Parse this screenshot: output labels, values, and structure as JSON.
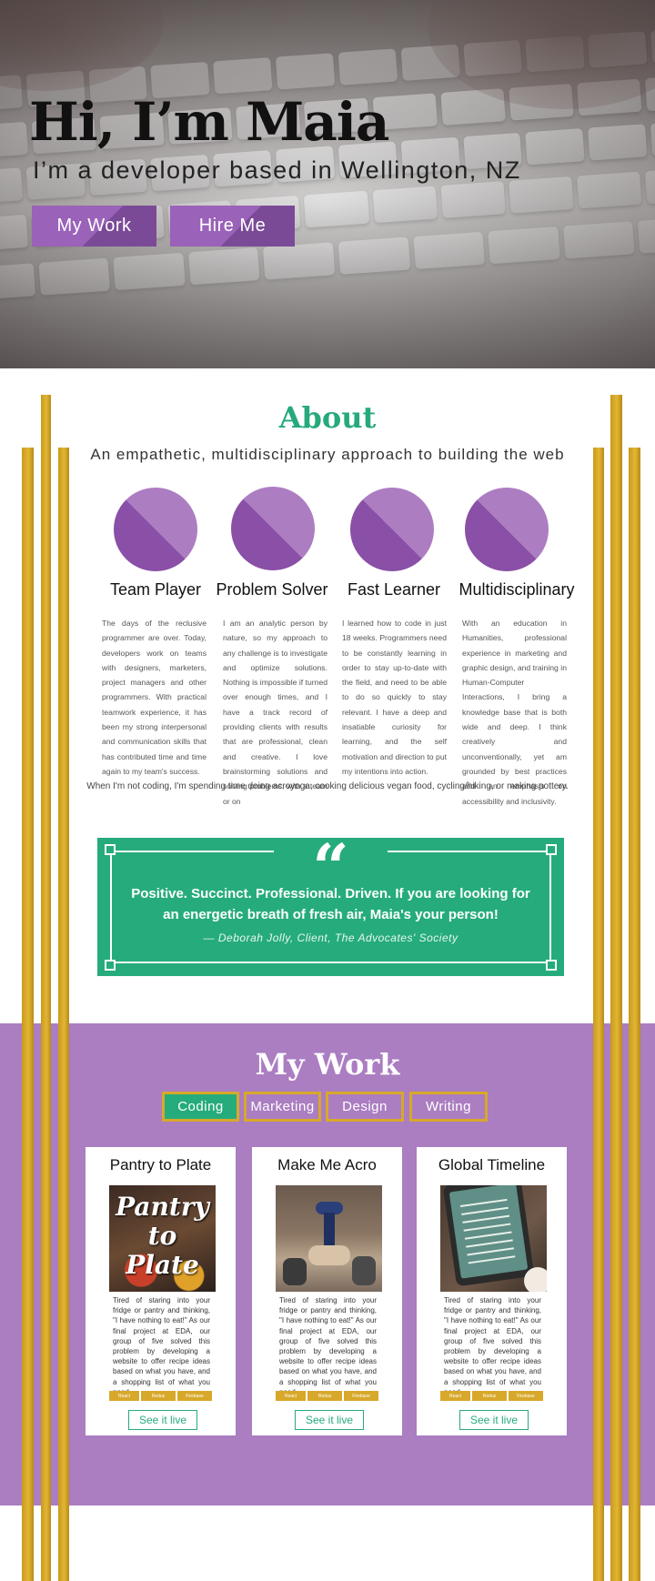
{
  "hero": {
    "title": "Hi, I’m Maia",
    "subtitle": "I’m a developer based in Wellington, NZ",
    "btn_work": "My Work",
    "btn_hire": "Hire Me"
  },
  "about": {
    "title": "About",
    "subtitle": "An empathetic, multidisciplinary approach to building the web",
    "features": [
      {
        "title": "Team Player",
        "text": "The days of the reclusive programmer are over. Today, developers work on teams with designers, marketers, project managers and other programmers. With practical teamwork experience, it has been my strong interpersonal and communication skills that has contributed time and time again to my team's success."
      },
      {
        "title": "Problem Solver",
        "text": "I am an analytic person by nature, so my approach to any challenge is to investigate and optimize solutions. Nothing is impossible if turned over enough times, and I have a track record of providing clients with results that are professional, clean and creative. I love brainstorming solutions and solving problems, with a team or on"
      },
      {
        "title": "Fast Learner",
        "text": "I learned how to code in just 18 weeks. Programmers need to be constantly learning in order to stay up-to-date with the field, and need to be able to do so quickly to stay relevant. I have a deep and insatiable curiosity for learning, and the self motivation and direction to put my intentions into action."
      },
      {
        "title": "Multidisciplinary",
        "text": "With an education in Humanities, professional experience in marketing and graphic design, and training in Human-Computer Interactions, I bring a knowledge base that is both wide and deep. I think creatively and unconventionally, yet am grounded by best practices and an emphasis on accessibility and inclusivity."
      }
    ],
    "hobby": "When I'm not coding, I'm spending time doing acroyoga, cooking delicious vegan food, cycling/hiking, or making pottery."
  },
  "testimonial": {
    "quote_mark": "“",
    "line1": "Positive. Succinct. Professional. Driven. If you are looking for",
    "line2": "an energetic breath of fresh air, Maia's your person!",
    "author": "— Deborah Jolly, Client, The Advocates' Society"
  },
  "work": {
    "title": "My Work",
    "filters": [
      "Coding",
      "Marketing",
      "Design",
      "Writing"
    ],
    "active_filter": "Coding",
    "projects": [
      {
        "title": "Pantry to Plate",
        "image_text": "Pantry to Plate",
        "text": "Tired of staring into your fridge or pantry and thinking, \"I have nothing to eat!\" As our final project at EDA, our group of five solved this problem by developing a website to offer recipe ideas based on what you have, and a shopping list of what you need.",
        "tags": [
          "React",
          "Redux",
          "Firebase"
        ],
        "button": "See it live"
      },
      {
        "title": "Make Me Acro",
        "image_text": "",
        "text": "Tired of staring into your fridge or pantry and thinking, \"I have nothing to eat!\" As our final project at EDA, our group of five solved this problem by developing a website to offer recipe ideas based on what you have, and a shopping list of what you need.",
        "tags": [
          "React",
          "Redux",
          "Firebase"
        ],
        "button": "See it live"
      },
      {
        "title": "Global Timeline",
        "image_text": "",
        "text": "Tired of staring into your fridge or pantry and thinking, \"I have nothing to eat!\" As our final project at EDA, our group of five solved this problem by developing a website to offer recipe ideas based on what you have, and a shopping list of what you need.",
        "tags": [
          "React",
          "Redux",
          "Firebase"
        ],
        "button": "See it live"
      }
    ]
  },
  "colors": {
    "green": "#26ac7c",
    "purple": "#ab7dc1",
    "gold": "#d8a82a"
  }
}
